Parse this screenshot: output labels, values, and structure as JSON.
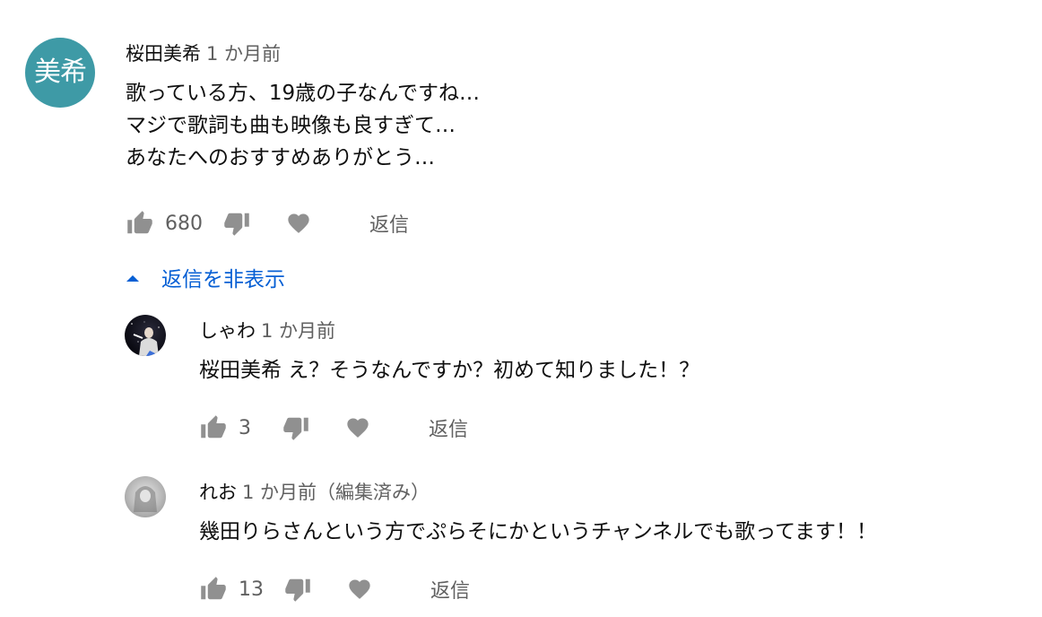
{
  "top_comment": {
    "avatar_text": "美希",
    "author": "桜田美希",
    "time": "1 か月前",
    "lines": [
      "歌っている方、19歳の子なんですね…",
      "マジで歌詞も曲も映像も良すぎて…",
      "あなたへのおすすめありがとう…"
    ],
    "likes": "680",
    "reply_label": "返信"
  },
  "toggle_replies_label": "返信を非表示",
  "replies": [
    {
      "author": "しゃわ",
      "time": "1 か月前",
      "text": "桜田美希 え？そうなんですか？初めて知りました！？",
      "likes": "3",
      "reply_label": "返信"
    },
    {
      "author": "れお",
      "time": "1 か月前（編集済み）",
      "text": "幾田りらさんという方でぷらそにかというチャンネルでも歌ってます！！",
      "likes": "13",
      "reply_label": "返信"
    }
  ],
  "colors": {
    "avatar_bg": "#3e9aa6",
    "link_blue": "#065fd4",
    "secondary_text": "#606060",
    "icon_gray": "#909090"
  },
  "icons": [
    "thumb-up-icon",
    "thumb-down-icon",
    "heart-icon",
    "caret-up-icon"
  ]
}
